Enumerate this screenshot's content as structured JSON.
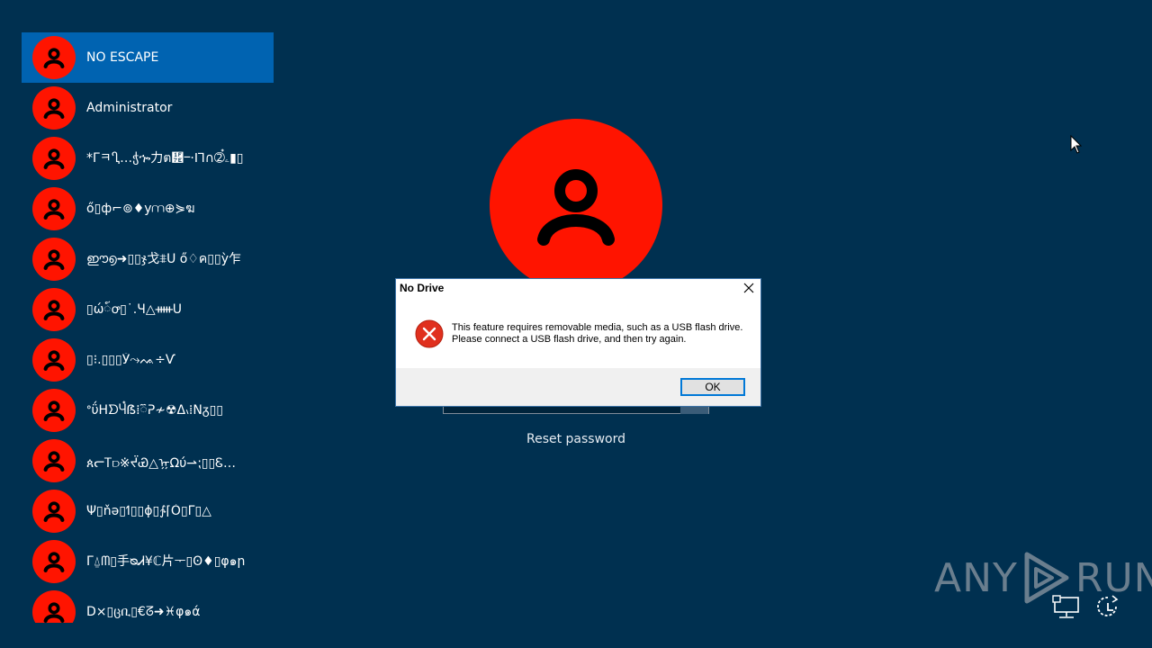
{
  "users": [
    {
      "name": "NO ESCAPE",
      "selected": true
    },
    {
      "name": "Administrator"
    },
    {
      "name": "*ΓㅋႢ…ჭኈ力ต὾ⲻ·ꓲ⅂∩➁๋ۦ▮▯"
    },
    {
      "name": "ő▯ф⌐⊚♦у⩋⊕⋟ฆ"
    },
    {
      "name": "ഈ൭➜▯▯ჯ戈⩨ᑌ ő♢ค▯▯ỳ乍"
    },
    {
      "name": "▯ώ៍ꝍ▯˙.Ч△ᚔᑌ"
    },
    {
      "name": "▯⁝.▯▯▯Ў⤳ᨕ÷Ѵ"
    },
    {
      "name": "ᐤΰΗᗤႷּ๋ẞ⁞៊ᕈ≁☢ᐃ៶⁞Νᵹ▯▯"
    },
    {
      "name": "ጰᓕᎢ⫐※ᔬᏯ△ᡍΩύ⇀⁏▯▯Ꮛ…"
    },
    {
      "name": "Ψ▯ňǝ▯ߗ▯▯ϕ▯∱⌈Ò▯ᒥ▯△"
    },
    {
      "name": "Γ⍙ᗰ▯手ᴓᏗ¥ℂ片ᅮ▯Ꙩ♦▯φ๑ր"
    },
    {
      "name": "D⨯▯ცቢ▯€ᘔ➜♓φ๑ά"
    }
  ],
  "reset_password": "Reset password",
  "dialog": {
    "title": "No Drive",
    "message_line1": "This feature requires removable media, such as a USB flash drive.",
    "message_line2": "Please connect a USB flash drive, and then try again.",
    "ok_label": "OK"
  },
  "watermark": {
    "left": "ANY",
    "right": "RUN"
  },
  "colors": {
    "background": "#003050",
    "selected": "#0063b1",
    "avatar": "#ff1400"
  }
}
